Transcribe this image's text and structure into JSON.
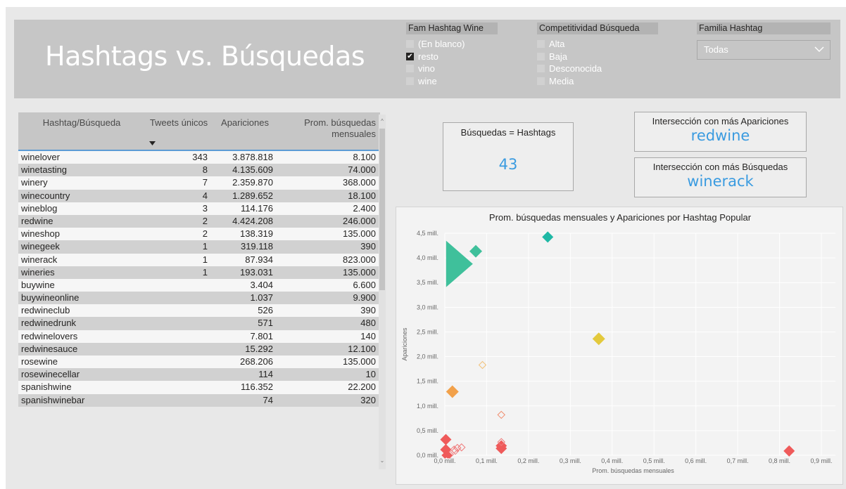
{
  "header": {
    "title": "Hashtags vs. Búsquedas"
  },
  "slicers": {
    "fam_wine": {
      "title": "Fam Hashtag Wine",
      "items": [
        {
          "label": "(En blanco)",
          "checked": false
        },
        {
          "label": "resto",
          "checked": true
        },
        {
          "label": "vino",
          "checked": false
        },
        {
          "label": "wine",
          "checked": false
        }
      ]
    },
    "competitividad": {
      "title": "Competitividad Búsqueda",
      "items": [
        {
          "label": "Alta",
          "checked": false
        },
        {
          "label": "Baja",
          "checked": false
        },
        {
          "label": "Desconocida",
          "checked": false
        },
        {
          "label": "Media",
          "checked": false
        }
      ]
    },
    "familia": {
      "title": "Familia Hashtag",
      "selected": "Todas"
    }
  },
  "table": {
    "headers": [
      "Hashtag/Búsqueda",
      "Tweets únicos",
      "Apariciones",
      "Prom. búsquedas mensuales"
    ],
    "rows": [
      [
        "winelover",
        "343",
        "3.878.818",
        "8.100"
      ],
      [
        "winetasting",
        "8",
        "4.135.609",
        "74.000"
      ],
      [
        "winery",
        "7",
        "2.359.870",
        "368.000"
      ],
      [
        "winecountry",
        "4",
        "1.289.652",
        "18.100"
      ],
      [
        "wineblog",
        "3",
        "114.176",
        "2.400"
      ],
      [
        "redwine",
        "2",
        "4.424.208",
        "246.000"
      ],
      [
        "wineshop",
        "2",
        "138.319",
        "135.000"
      ],
      [
        "winegeek",
        "1",
        "319.118",
        "390"
      ],
      [
        "winerack",
        "1",
        "87.934",
        "823.000"
      ],
      [
        "wineries",
        "1",
        "193.031",
        "135.000"
      ],
      [
        "buywine",
        "",
        "3.404",
        "6.600"
      ],
      [
        "buywineonline",
        "",
        "1.037",
        "9.900"
      ],
      [
        "redwineclub",
        "",
        "526",
        "390"
      ],
      [
        "redwinedrunk",
        "",
        "571",
        "480"
      ],
      [
        "redwinelovers",
        "",
        "7.801",
        "140"
      ],
      [
        "redwinesauce",
        "",
        "15.292",
        "12.100"
      ],
      [
        "rosewine",
        "",
        "268.206",
        "135.000"
      ],
      [
        "rosewinecellar",
        "",
        "114",
        "10"
      ],
      [
        "spanishwine",
        "",
        "116.352",
        "22.200"
      ],
      [
        "spanishwinebar",
        "",
        "74",
        "320"
      ]
    ]
  },
  "cards": {
    "matches": {
      "label": "Búsquedas = Hashtags",
      "value": "43"
    },
    "top_apariciones": {
      "label": "Intersección con más Apariciones",
      "value": "redwine"
    },
    "top_busquedas": {
      "label": "Intersección con más Búsquedas",
      "value": "winerack"
    }
  },
  "colors": {
    "accent": "#3a9be0",
    "teal": "#1fb8a5",
    "orange": "#f2a14a",
    "yellow": "#e3c93c",
    "red": "#ef5a5a"
  },
  "chart_data": {
    "type": "scatter",
    "title": "Prom. búsquedas mensuales y Apariciones por Hashtag Popular",
    "xlabel": "Prom. búsquedas mensuales",
    "ylabel": "Apariciones",
    "xlim": [
      0,
      900000
    ],
    "ylim": [
      0,
      4500000
    ],
    "xticks": [
      "0,0 mill.",
      "0,1 mill.",
      "0,2 mill.",
      "0,3 mill.",
      "0,4 mill.",
      "0,5 mill.",
      "0,6 mill.",
      "0,7 mill.",
      "0,8 mill.",
      "0,9 mill."
    ],
    "yticks": [
      "0,0 mill.",
      "0,5 mill.",
      "1,0 mill.",
      "1,5 mill.",
      "2,0 mill.",
      "2,5 mill.",
      "3,0 mill.",
      "3,5 mill.",
      "4,0 mill.",
      "4,5 mill."
    ],
    "grid": true,
    "points": [
      {
        "x": 8100,
        "y": 3878818,
        "color": "#3fc09b",
        "size": 343,
        "filled": true
      },
      {
        "x": 74000,
        "y": 4135609,
        "color": "#3fc09b",
        "size": 8,
        "filled": true
      },
      {
        "x": 246000,
        "y": 4424208,
        "color": "#1fb8a5",
        "size": 2,
        "filled": true
      },
      {
        "x": 368000,
        "y": 2359870,
        "color": "#e3c93c",
        "size": 7,
        "filled": true
      },
      {
        "x": 18100,
        "y": 1289652,
        "color": "#f2a14a",
        "size": 4,
        "filled": true
      },
      {
        "x": 90000,
        "y": 1830000,
        "color": "#f2c27a",
        "size": 0,
        "filled": false
      },
      {
        "x": 135000,
        "y": 820000,
        "color": "#f08a6a",
        "size": 0,
        "filled": false
      },
      {
        "x": 823000,
        "y": 87934,
        "color": "#ef5a5a",
        "size": 1,
        "filled": true
      },
      {
        "x": 135000,
        "y": 193031,
        "color": "#ef5a5a",
        "size": 1,
        "filled": true
      },
      {
        "x": 135000,
        "y": 138319,
        "color": "#ef5a5a",
        "size": 2,
        "filled": true
      },
      {
        "x": 135000,
        "y": 268206,
        "color": "#ef7a7a",
        "size": 0,
        "filled": false
      },
      {
        "x": 2400,
        "y": 319118,
        "color": "#ef5a5a",
        "size": 1,
        "filled": true
      },
      {
        "x": 2400,
        "y": 114176,
        "color": "#ef5a5a",
        "size": 3,
        "filled": true
      },
      {
        "x": 22200,
        "y": 116352,
        "color": "#ef7a7a",
        "size": 0,
        "filled": false
      },
      {
        "x": 12100,
        "y": 15292,
        "color": "#ef7a7a",
        "size": 0,
        "filled": false
      },
      {
        "x": 6600,
        "y": 3404,
        "color": "#ef5a5a",
        "size": 0,
        "filled": true
      },
      {
        "x": 9900,
        "y": 1037,
        "color": "#ef5a5a",
        "size": 0,
        "filled": true
      },
      {
        "x": 30000,
        "y": 150000,
        "color": "#ef7a7a",
        "size": 0,
        "filled": false
      },
      {
        "x": 40000,
        "y": 160000,
        "color": "#ef7a7a",
        "size": 0,
        "filled": false
      },
      {
        "x": 25000,
        "y": 90000,
        "color": "#ef7a7a",
        "size": 0,
        "filled": false
      },
      {
        "x": 480,
        "y": 571,
        "color": "#ef5a5a",
        "size": 0,
        "filled": true
      }
    ]
  }
}
